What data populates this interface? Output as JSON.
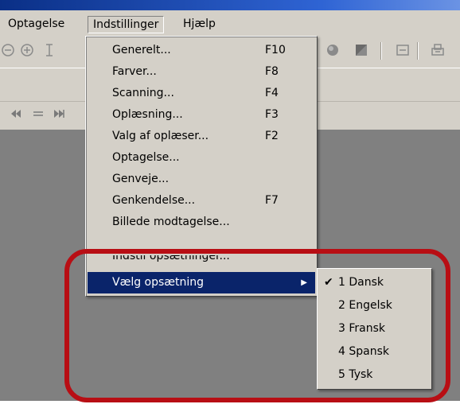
{
  "menubar": {
    "items": [
      {
        "label": "Optagelse"
      },
      {
        "label": "Indstillinger"
      },
      {
        "label": "Hjælp"
      }
    ]
  },
  "toolbar": {
    "icons": [
      "zoom-out-icon",
      "zoom-in-icon",
      "text-cursor-icon",
      "circle-icon",
      "square-icon",
      "window-icon",
      "printer-icon"
    ]
  },
  "nav": {
    "icons": [
      "rewind-icon",
      "lines-icon",
      "fast-forward-icon"
    ]
  },
  "settings_menu": {
    "items": [
      {
        "label": "Generelt...",
        "shortcut": "F10"
      },
      {
        "label": "Farver...",
        "shortcut": "F8"
      },
      {
        "label": "Scanning...",
        "shortcut": "F4"
      },
      {
        "label": "Oplæsning...",
        "shortcut": "F3"
      },
      {
        "label": "Valg af oplæser...",
        "shortcut": "F2"
      },
      {
        "label": "Optagelse...",
        "shortcut": ""
      },
      {
        "label": "Genveje...",
        "shortcut": ""
      },
      {
        "label": "Genkendelse...",
        "shortcut": "F7"
      },
      {
        "label": "Billede modtagelse...",
        "shortcut": ""
      },
      {
        "label": "Indstil opsætninger...",
        "shortcut": ""
      },
      {
        "label": "Vælg opsætning",
        "shortcut": "",
        "submenu": true,
        "highlighted": true
      }
    ]
  },
  "profile_submenu": {
    "items": [
      {
        "label": "1 Dansk",
        "checked": true
      },
      {
        "label": "2 Engelsk",
        "checked": false
      },
      {
        "label": "3 Fransk",
        "checked": false
      },
      {
        "label": "4 Spansk",
        "checked": false
      },
      {
        "label": "5 Tysk",
        "checked": false
      }
    ]
  },
  "colors": {
    "menu_bg": "#d4d0c8",
    "highlight": "#0a246a",
    "workspace": "#808080",
    "annotation_ring": "#b80e14"
  }
}
